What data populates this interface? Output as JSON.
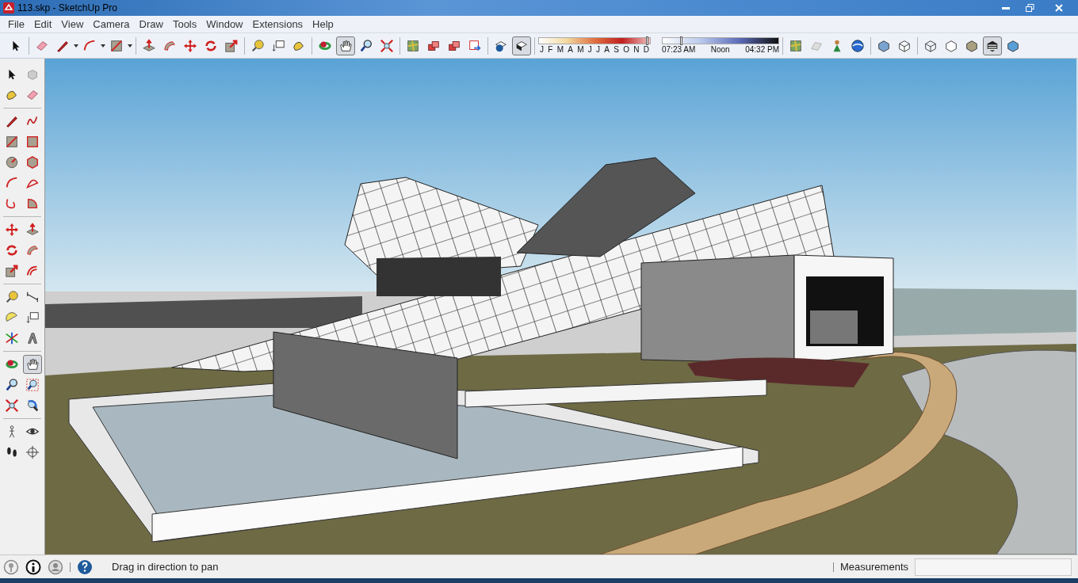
{
  "window": {
    "title": "113.skp - SketchUp Pro"
  },
  "menu": [
    "File",
    "Edit",
    "View",
    "Camera",
    "Draw",
    "Tools",
    "Window",
    "Extensions",
    "Help"
  ],
  "toolbar": [
    {
      "kind": "tools",
      "tools": [
        {
          "selected": false
        }
      ]
    },
    {
      "kind": "tools",
      "tools": [
        {
          "selected": false
        },
        {
          "selected": false
        },
        {
          "selected": false
        },
        {
          "selected": false
        }
      ]
    },
    {
      "kind": "tools",
      "tools": [
        {
          "selected": false
        },
        {
          "selected": false
        },
        {
          "selected": false
        },
        {
          "selected": false
        },
        {
          "selected": false
        }
      ]
    },
    {
      "kind": "tools",
      "tools": [
        {
          "selected": false
        },
        {
          "selected": false
        },
        {
          "selected": false
        }
      ]
    },
    {
      "kind": "tools",
      "tools": [
        {
          "selected": false
        },
        {
          "selected": true
        },
        {
          "selected": false
        },
        {
          "selected": false
        }
      ]
    },
    {
      "kind": "tools",
      "tools": [
        {
          "selected": false
        },
        {
          "selected": false
        },
        {
          "selected": false
        },
        {
          "selected": false
        }
      ]
    },
    {
      "kind": "tools",
      "tools": [
        {
          "selected": false
        },
        {
          "selected": true
        }
      ]
    },
    {
      "kind": "shadow",
      "months": [
        "J",
        "F",
        "M",
        "A",
        "M",
        "J",
        "J",
        "A",
        "S",
        "O",
        "N",
        "D"
      ],
      "month_slider": {
        "level": 0.98
      },
      "times": [
        "07:23 AM",
        "Noon",
        "04:32 PM"
      ],
      "time_slider": {
        "level": 0.15
      }
    },
    {
      "kind": "tools",
      "tools": [
        {
          "selected": false
        },
        {
          "selected": false
        },
        {
          "selected": false
        },
        {
          "selected": false
        }
      ]
    },
    {
      "kind": "tools",
      "tools": [
        {
          "selected": false
        },
        {
          "selected": false
        }
      ]
    },
    {
      "kind": "tools",
      "tools": [
        {
          "selected": false
        },
        {
          "selected": false
        },
        {
          "selected": false
        },
        {
          "selected": true
        },
        {
          "selected": false
        }
      ]
    }
  ],
  "left_toolbar": [
    [
      {
        "selected": false
      },
      {
        "selected": false
      },
      {
        "selected": false
      },
      {
        "selected": false
      }
    ],
    [
      {
        "selected": false
      },
      {
        "selected": false
      },
      {
        "selected": false
      },
      {
        "selected": false
      },
      {
        "selected": false
      },
      {
        "selected": false
      },
      {
        "selected": false
      },
      {
        "selected": false
      },
      {
        "selected": false
      },
      {
        "selected": false
      }
    ],
    [
      {
        "selected": false
      },
      {
        "selected": false
      },
      {
        "selected": false
      },
      {
        "selected": false
      },
      {
        "selected": false
      },
      {
        "selected": false
      }
    ],
    [
      {
        "selected": false
      },
      {
        "selected": false
      },
      {
        "selected": false
      },
      {
        "selected": false
      },
      {
        "selected": false
      },
      {
        "selected": false
      }
    ],
    [
      {
        "selected": false
      },
      {
        "selected": true
      },
      {
        "selected": false
      },
      {
        "selected": false
      },
      {
        "selected": false
      },
      {
        "selected": false
      }
    ],
    [
      {
        "selected": false
      },
      {
        "selected": false
      },
      {
        "selected": false
      },
      {
        "selected": false
      }
    ]
  ],
  "status_bar": {
    "message": "Drag in direction to pan",
    "measurements_label": "Measurements"
  }
}
